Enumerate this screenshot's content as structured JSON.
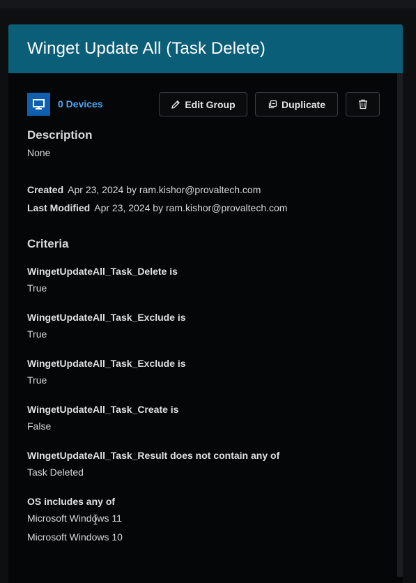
{
  "panel": {
    "title": "Winget Update All (Task Delete)"
  },
  "toolbar": {
    "devices_label": "0 Devices",
    "edit_label": "Edit Group",
    "duplicate_label": "Duplicate",
    "device_icon": "monitor-icon",
    "edit_icon": "pencil-icon",
    "duplicate_icon": "copy-icon",
    "delete_icon": "trash-icon"
  },
  "description": {
    "heading": "Description",
    "value": "None"
  },
  "meta": {
    "created_label": "Created",
    "created_value": "Apr 23, 2024 by ram.kishor@provaltech.com",
    "modified_label": "Last Modified",
    "modified_value": "Apr 23, 2024 by ram.kishor@provaltech.com"
  },
  "criteria": {
    "heading": "Criteria",
    "items": [
      {
        "label": "WingetUpdateAll_Task_Delete is",
        "values": [
          "True"
        ]
      },
      {
        "label": "WingetUpdateAll_Task_Exclude is",
        "values": [
          "True"
        ]
      },
      {
        "label": "WingetUpdateAll_Task_Exclude is",
        "values": [
          "True"
        ]
      },
      {
        "label": "WingetUpdateAll_Task_Create is",
        "values": [
          "False"
        ]
      },
      {
        "label": "WIngetUpdateAll_Task_Result does not contain any of",
        "values": [
          "Task Deleted"
        ]
      },
      {
        "label": "OS includes any of",
        "values": [
          "Microsoft Windows 11",
          "Microsoft Windows 10"
        ]
      }
    ]
  },
  "colors": {
    "header_bg": "#0b5e78",
    "link": "#4da6f5",
    "device_icon_bg": "#0f5fae"
  }
}
